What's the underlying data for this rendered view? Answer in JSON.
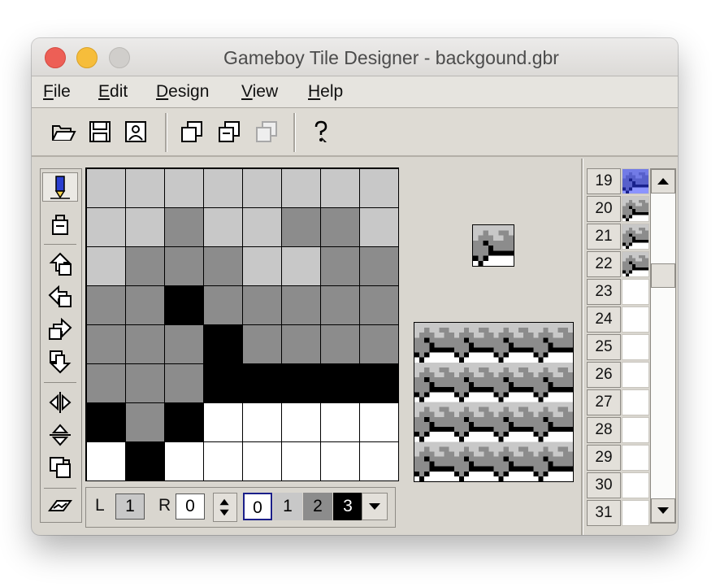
{
  "window": {
    "title": "Gameboy Tile Designer - backgound.gbr"
  },
  "menu": [
    {
      "mnemonic": "F",
      "rest": "ile"
    },
    {
      "mnemonic": "E",
      "rest": "dit"
    },
    {
      "mnemonic": "D",
      "rest": "esign"
    },
    {
      "mnemonic": "V",
      "rest": "iew"
    },
    {
      "mnemonic": "H",
      "rest": "elp"
    }
  ],
  "toolbar": {
    "buttons": [
      "open-icon",
      "save-icon",
      "save-as-icon",
      "copy-icon",
      "paste-icon",
      "paste-disabled-icon",
      "help-icon"
    ]
  },
  "tools": [
    "pencil-icon",
    "flood-fill-icon",
    "scroll-up-icon",
    "scroll-left-icon",
    "scroll-right-icon",
    "scroll-down-icon",
    "flip-horizontal-icon",
    "flip-vertical-icon",
    "rotate-icon",
    "auto-update-icon"
  ],
  "palette": {
    "colors": [
      "#ffffff",
      "#c8c8c8",
      "#8c8c8c",
      "#000000"
    ]
  },
  "tile_pixels": [
    [
      1,
      1,
      1,
      1,
      1,
      1,
      1,
      1
    ],
    [
      1,
      1,
      2,
      1,
      1,
      2,
      2,
      1
    ],
    [
      1,
      2,
      2,
      2,
      1,
      1,
      2,
      2
    ],
    [
      2,
      2,
      3,
      2,
      2,
      2,
      2,
      2
    ],
    [
      2,
      2,
      2,
      3,
      2,
      2,
      2,
      2
    ],
    [
      2,
      2,
      2,
      3,
      3,
      3,
      3,
      3
    ],
    [
      3,
      2,
      3,
      0,
      0,
      0,
      0,
      0
    ],
    [
      0,
      3,
      0,
      0,
      0,
      0,
      0,
      0
    ]
  ],
  "bottom_bar": {
    "left_label": "L",
    "left_value": "1",
    "right_label": "R",
    "right_value": "0",
    "palette_labels": [
      "0",
      "1",
      "2",
      "3"
    ]
  },
  "tile_list": {
    "numbers": [
      "19",
      "20",
      "21",
      "22",
      "23",
      "24",
      "25",
      "26",
      "27",
      "28",
      "29",
      "30",
      "31"
    ],
    "selected": "19"
  }
}
